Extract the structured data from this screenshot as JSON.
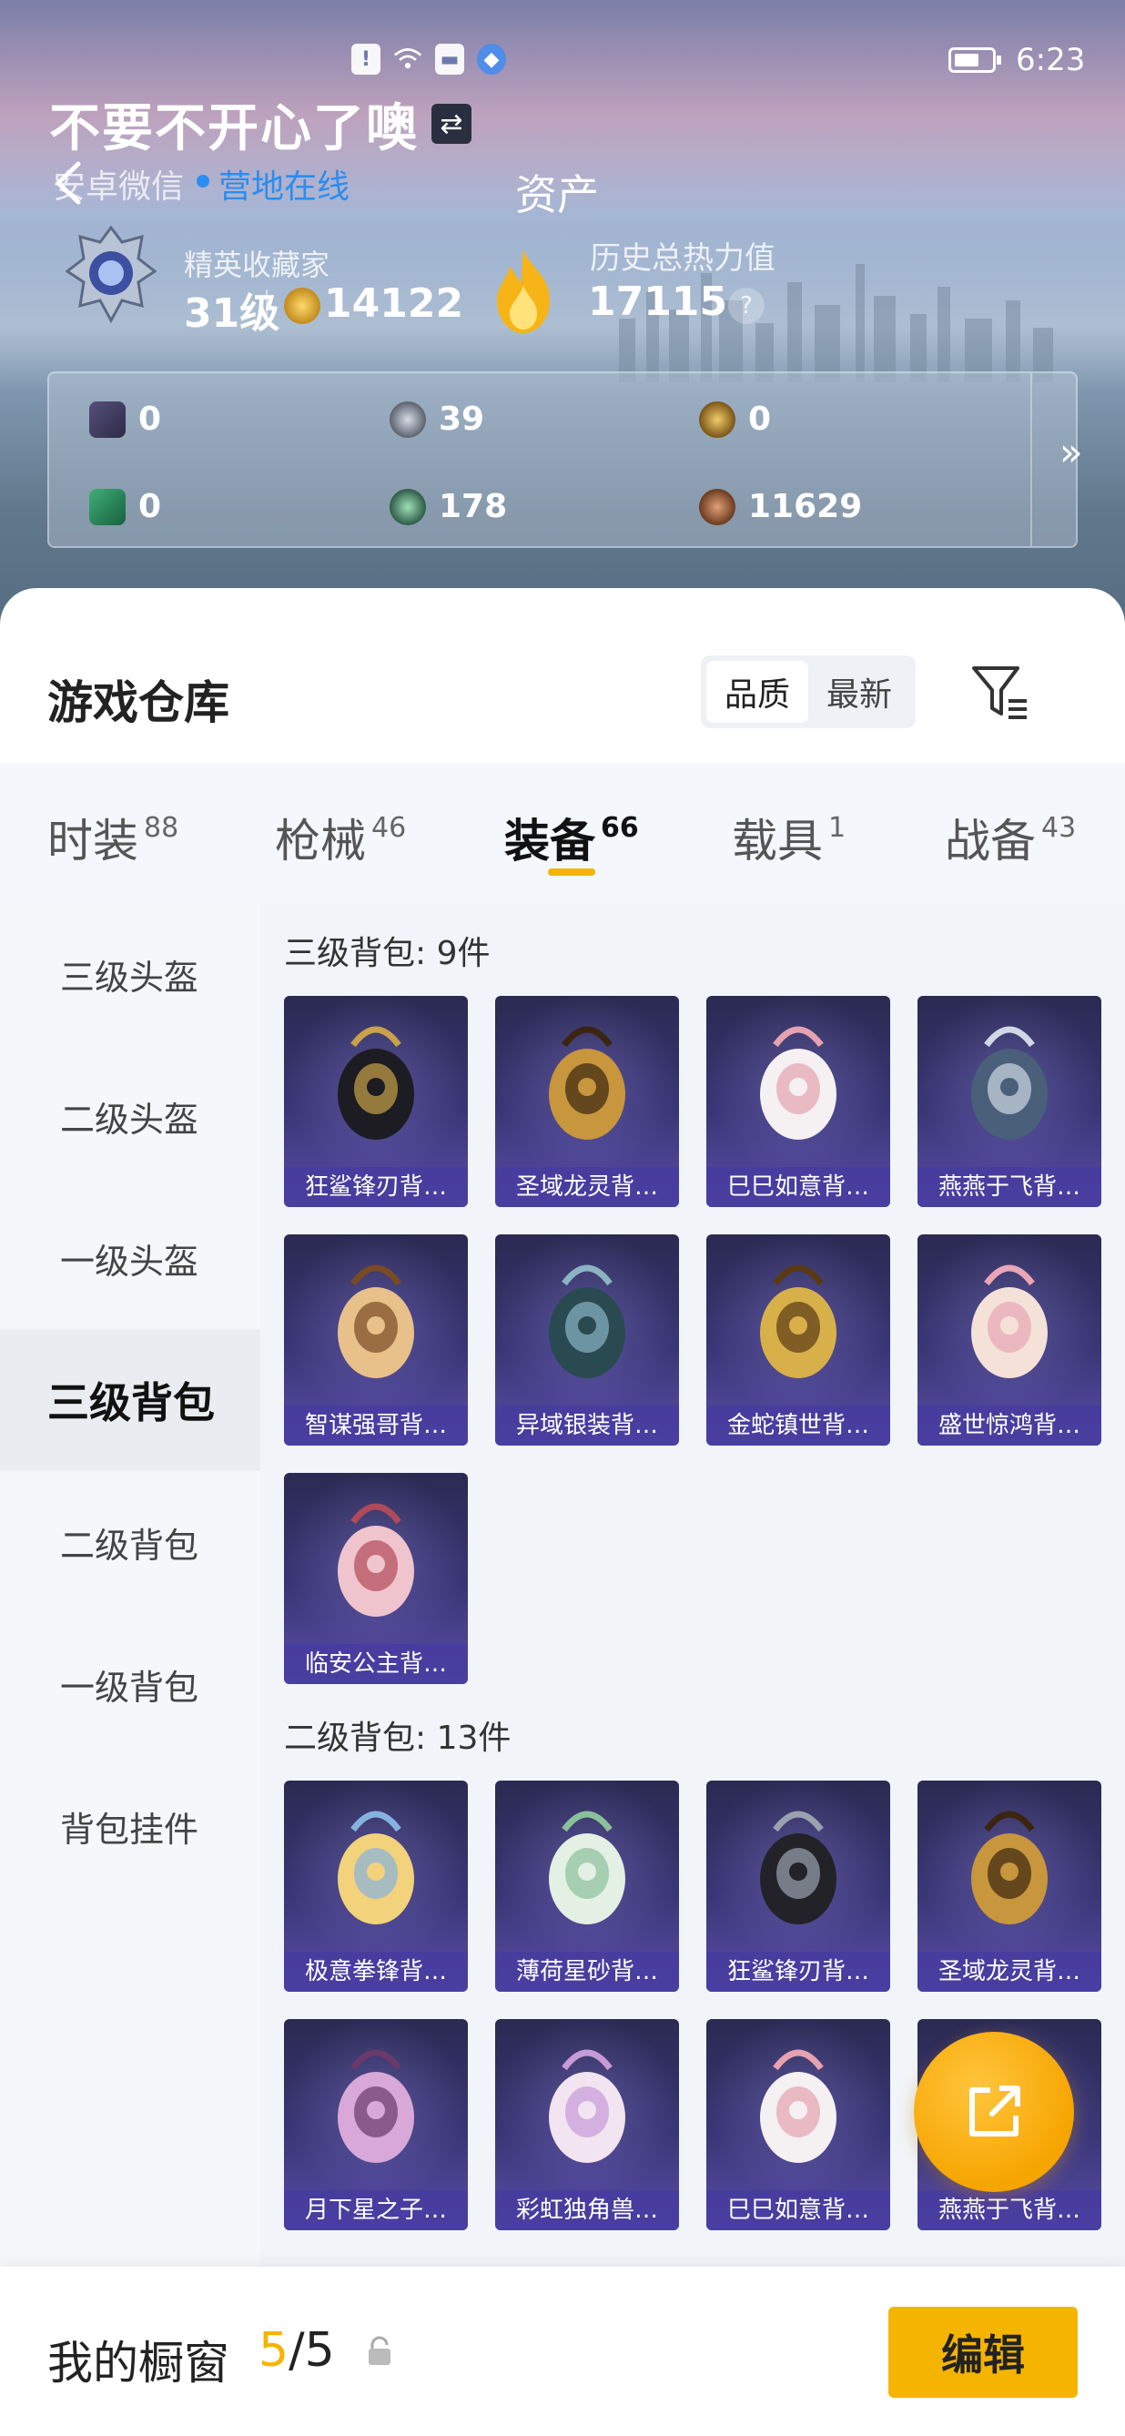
{
  "status_bar": {
    "time": "6:23"
  },
  "header": {
    "nickname": "不要不开心了噢",
    "platform": "安卓微信",
    "online_status": "营地在线",
    "page_title": "资产",
    "rank_label": "精英收藏家",
    "rank_level": "31级",
    "points": "14122",
    "hot_label": "历史总热力值",
    "hot_value": "17115",
    "help": "?"
  },
  "currencies": [
    {
      "icon": "purple-card-icon",
      "value": "0"
    },
    {
      "icon": "silver-coin-icon",
      "value": "39"
    },
    {
      "icon": "gold-coin-icon",
      "value": "0"
    },
    {
      "icon": "green-card-icon",
      "value": "0"
    },
    {
      "icon": "green-coin-icon",
      "value": "178"
    },
    {
      "icon": "bronze-coin-icon",
      "value": "11629"
    }
  ],
  "warehouse": {
    "title": "游戏仓库",
    "sort_options": [
      "品质",
      "最新"
    ],
    "active_sort": "品质"
  },
  "tabs": [
    {
      "label": "时装",
      "count": "88"
    },
    {
      "label": "枪械",
      "count": "46"
    },
    {
      "label": "装备",
      "count": "66",
      "active": true
    },
    {
      "label": "载具",
      "count": "1"
    },
    {
      "label": "战备",
      "count": "43"
    }
  ],
  "sidebar": [
    {
      "label": "三级头盔"
    },
    {
      "label": "二级头盔"
    },
    {
      "label": "一级头盔"
    },
    {
      "label": "三级背包",
      "active": true
    },
    {
      "label": "二级背包"
    },
    {
      "label": "一级背包"
    },
    {
      "label": "背包挂件"
    }
  ],
  "sections": [
    {
      "title": "三级背包: 9件",
      "items": [
        "狂鲨锋刃背…",
        "圣域龙灵背…",
        "巳巳如意背…",
        "燕燕于飞背…",
        "智谋强哥背…",
        "异域银装背…",
        "金蛇镇世背…",
        "盛世惊鸿背…",
        "临安公主背…"
      ]
    },
    {
      "title": "二级背包: 13件",
      "items": [
        "极意拳锋背…",
        "薄荷星砂背…",
        "狂鲨锋刃背…",
        "圣域龙灵背…",
        "月下星之子…",
        "彩虹独角兽…",
        "巳巳如意背…",
        "燕燕于飞背…"
      ]
    }
  ],
  "showcase": {
    "label": "我的橱窗",
    "count_current": "5",
    "count_total": "/5",
    "edit_label": "编辑"
  },
  "colors": {
    "accent": "#f5b400",
    "online": "#2a8df0",
    "item_bg": "#3a3676"
  }
}
